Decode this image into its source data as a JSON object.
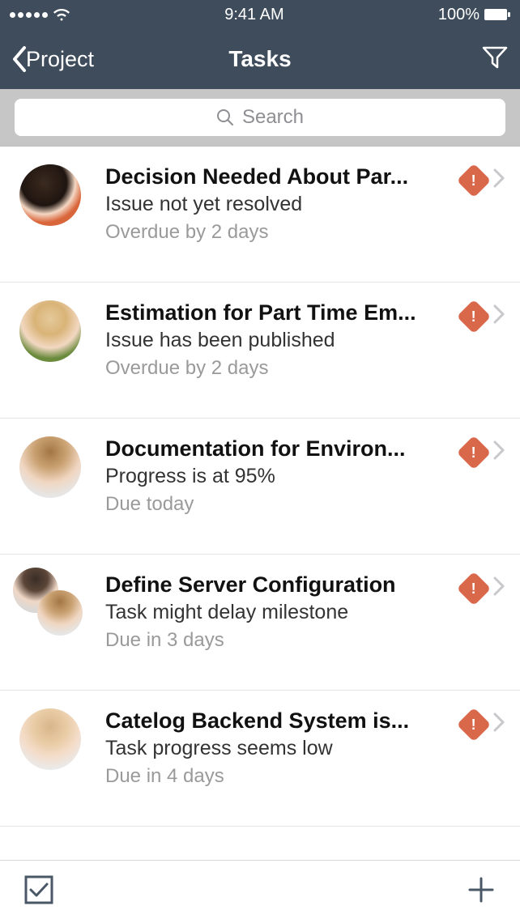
{
  "status": {
    "time": "9:41 AM",
    "battery_text": "100%"
  },
  "nav": {
    "back_label": "Project",
    "title": "Tasks"
  },
  "search": {
    "placeholder": "Search"
  },
  "tasks": [
    {
      "title": "Decision Needed About Par...",
      "subtitle": "Issue not yet resolved",
      "meta": "Overdue by 2 days",
      "avatar_class": "av-1",
      "stacked": false,
      "alert": true
    },
    {
      "title": "Estimation for Part Time Em...",
      "subtitle": "Issue has been published",
      "meta": "Overdue by 2 days",
      "avatar_class": "av-2",
      "stacked": false,
      "alert": true
    },
    {
      "title": "Documentation for Environ...",
      "subtitle": "Progress is at 95%",
      "meta": "Due today",
      "avatar_class": "av-3",
      "stacked": false,
      "alert": true
    },
    {
      "title": "Define Server Configuration",
      "subtitle": "Task might delay milestone",
      "meta": "Due in 3 days",
      "avatar_class": "av-4",
      "avatar2_class": "av-3",
      "stacked": true,
      "alert": true
    },
    {
      "title": "Catelog Backend System is...",
      "subtitle": "Task progress seems low",
      "meta": "Due in 4 days",
      "avatar_class": "av-5",
      "stacked": false,
      "alert": true
    }
  ]
}
